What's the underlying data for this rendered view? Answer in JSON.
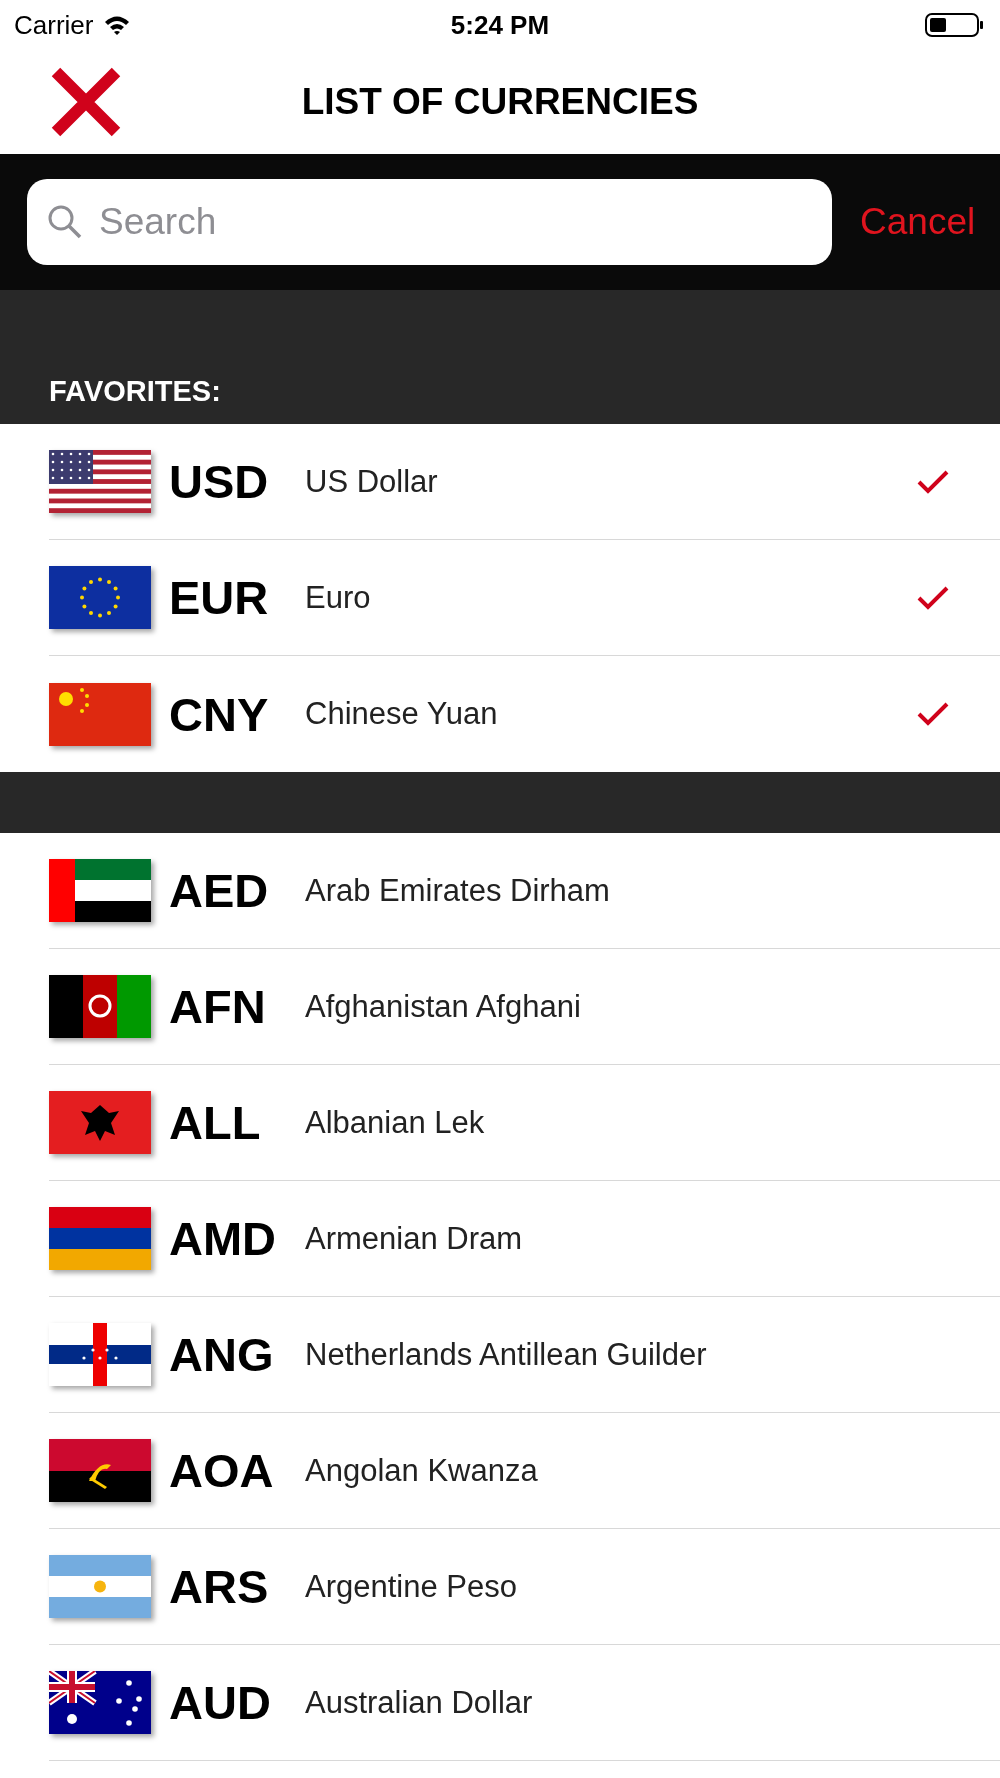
{
  "status_bar": {
    "carrier": "Carrier",
    "time": "5:24 PM"
  },
  "header": {
    "title": "LIST OF CURRENCIES"
  },
  "search": {
    "placeholder": "Search",
    "cancel": "Cancel"
  },
  "favorites": {
    "label": "FAVORITES:",
    "items": [
      {
        "kind": "us",
        "code": "USD",
        "name": "US Dollar",
        "checked": true
      },
      {
        "kind": "eu",
        "code": "EUR",
        "name": "Euro",
        "checked": true
      },
      {
        "kind": "cn",
        "code": "CNY",
        "name": "Chinese Yuan",
        "checked": true
      }
    ]
  },
  "currencies": [
    {
      "kind": "ae",
      "code": "AED",
      "name": "Arab Emirates Dirham"
    },
    {
      "kind": "af",
      "code": "AFN",
      "name": "Afghanistan Afghani"
    },
    {
      "kind": "al",
      "code": "ALL",
      "name": "Albanian Lek"
    },
    {
      "kind": "am",
      "code": "AMD",
      "name": "Armenian Dram"
    },
    {
      "kind": "an",
      "code": "ANG",
      "name": "Netherlands Antillean Guilder"
    },
    {
      "kind": "ao",
      "code": "AOA",
      "name": "Angolan Kwanza"
    },
    {
      "kind": "ar",
      "code": "ARS",
      "name": "Argentine Peso"
    },
    {
      "kind": "au",
      "code": "AUD",
      "name": "Australian Dollar"
    }
  ]
}
